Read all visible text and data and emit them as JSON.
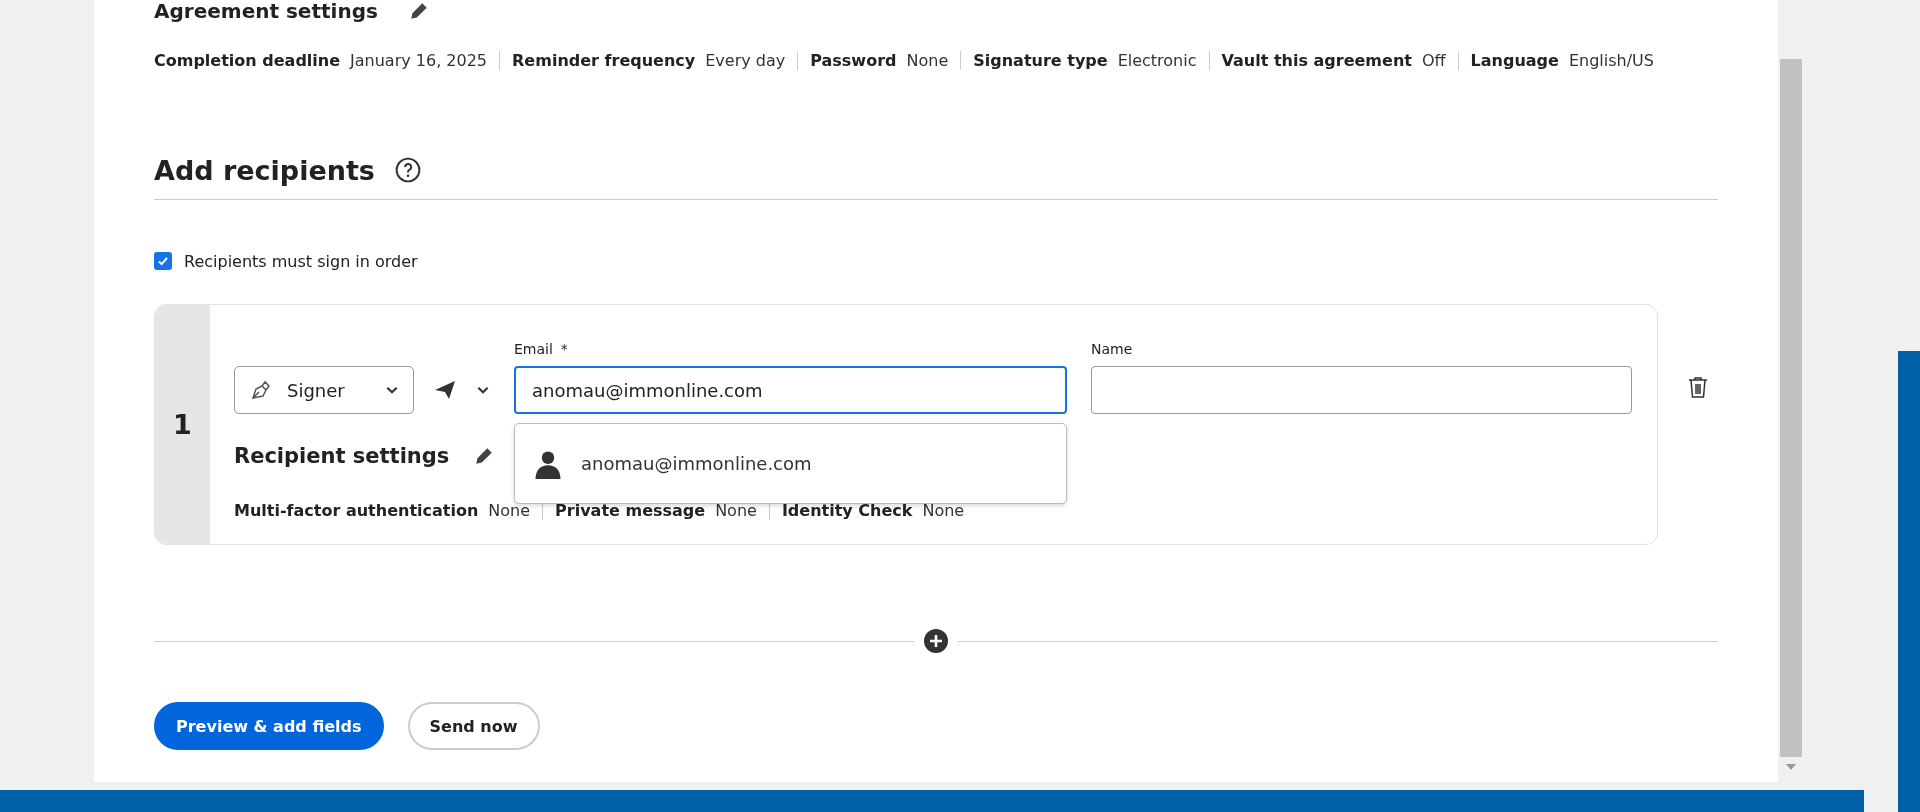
{
  "agreement_settings": {
    "title": "Agreement settings",
    "items": [
      {
        "label": "Completion deadline",
        "value": "January 16, 2025"
      },
      {
        "label": "Reminder frequency",
        "value": "Every day"
      },
      {
        "label": "Password",
        "value": "None"
      },
      {
        "label": "Signature type",
        "value": "Electronic"
      },
      {
        "label": "Vault this agreement",
        "value": "Off"
      },
      {
        "label": "Language",
        "value": "English/US"
      }
    ]
  },
  "add_recipients": {
    "title": "Add recipients",
    "sign_in_order": {
      "label": "Recipients must sign in order",
      "checked": true
    },
    "recipients": [
      {
        "number": "1",
        "role": "Signer",
        "email_label": "Email",
        "required_mark": "*",
        "email": "anomau@immonline.com",
        "name_label": "Name",
        "suggestions": [
          "anomau@immonline.com"
        ],
        "settings_title": "Recipient settings",
        "settings": [
          {
            "label": "Multi-factor authentication",
            "value": "None"
          },
          {
            "label": "Private message",
            "value": "None"
          },
          {
            "label": "Identity Check",
            "value": "None"
          }
        ]
      }
    ]
  },
  "buttons": [
    {
      "label": "Preview & add fields",
      "kind": "primary"
    },
    {
      "label": "Send now",
      "kind": "secondary"
    }
  ]
}
